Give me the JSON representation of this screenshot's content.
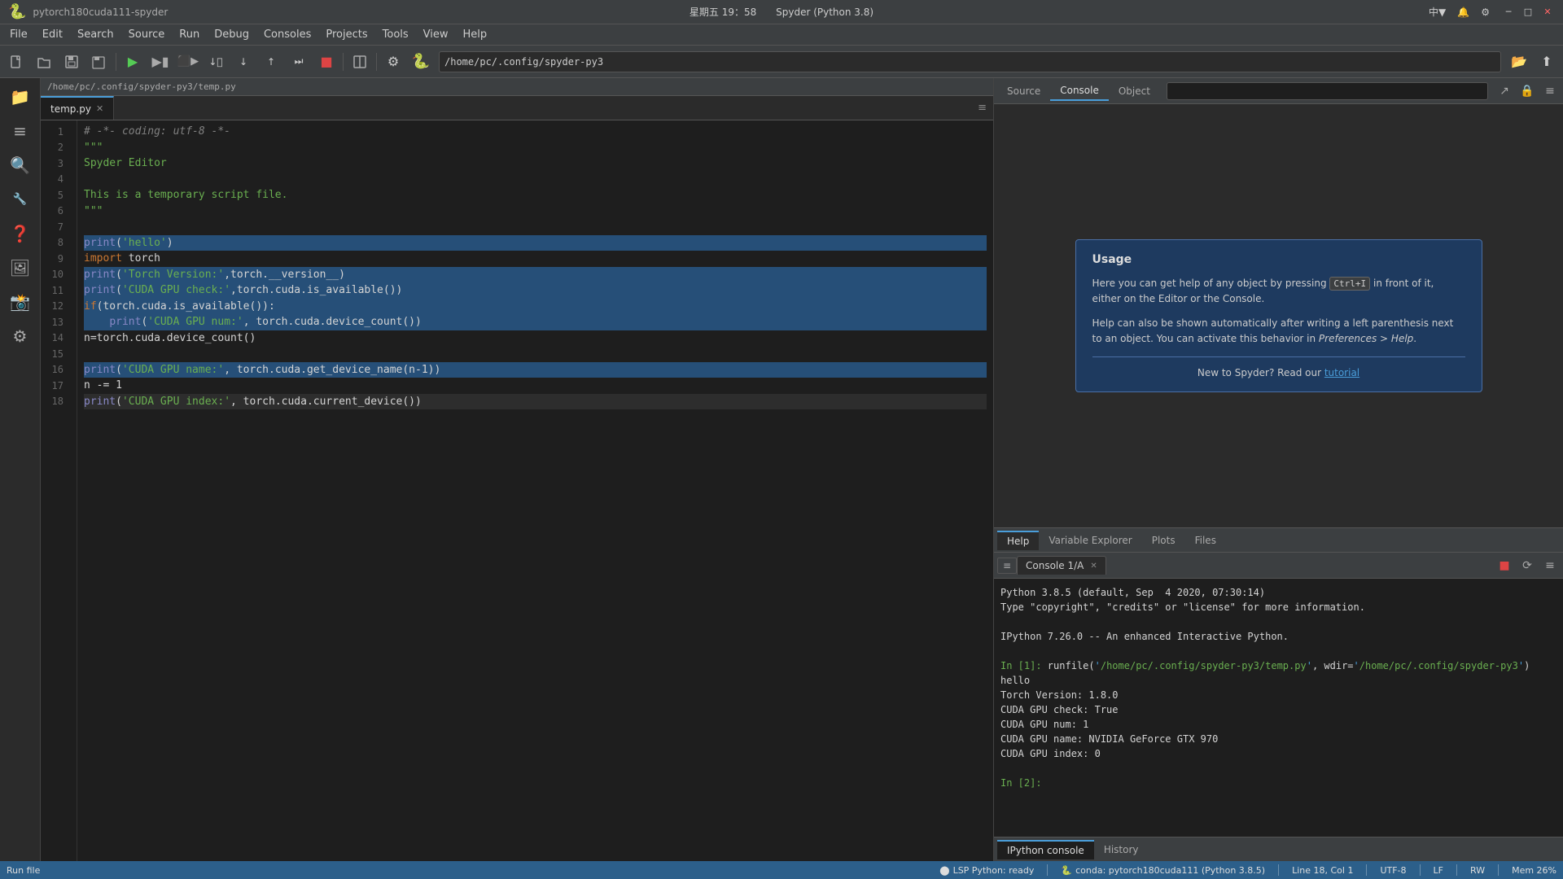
{
  "titlebar": {
    "app_name": "pytorch180cuda111-spyder",
    "time": "星期五 19：58",
    "window_title": "Spyder (Python 3.8)",
    "minimize": "─",
    "maximize": "□",
    "close": "✕",
    "lang": "中▼"
  },
  "menubar": {
    "items": [
      "File",
      "Edit",
      "Search",
      "Source",
      "Run",
      "Debug",
      "Consoles",
      "Projects",
      "Tools",
      "View",
      "Help"
    ]
  },
  "toolbar": {
    "path": "/home/pc/.config/spyder-py3",
    "buttons": [
      "new",
      "open",
      "save",
      "save-all",
      "run",
      "run-cell",
      "debug-step",
      "step-into",
      "step-out",
      "continue",
      "stop",
      "split"
    ]
  },
  "editor": {
    "path": "/home/pc/.config/spyder-py3/temp.py",
    "tab_label": "temp.py",
    "lines": [
      {
        "num": 1,
        "code": "# -*- coding: utf-8 -*-",
        "type": "comment"
      },
      {
        "num": 2,
        "code": "\"\"\"",
        "type": "string"
      },
      {
        "num": 3,
        "code": "Spyder Editor",
        "type": "string"
      },
      {
        "num": 4,
        "code": "",
        "type": "normal"
      },
      {
        "num": 5,
        "code": "This is a temporary script file.",
        "type": "string"
      },
      {
        "num": 6,
        "code": "\"\"\"",
        "type": "string"
      },
      {
        "num": 7,
        "code": "",
        "type": "normal"
      },
      {
        "num": 8,
        "code": "print('hello')",
        "type": "highlighted"
      },
      {
        "num": 9,
        "code": "import torch",
        "type": "normal"
      },
      {
        "num": 10,
        "code": "print('Torch Version:',torch.__version__)",
        "type": "highlighted"
      },
      {
        "num": 11,
        "code": "print('CUDA GPU check:',torch.cuda.is_available())",
        "type": "highlighted"
      },
      {
        "num": 12,
        "code": "if(torch.cuda.is_available()):",
        "type": "highlighted"
      },
      {
        "num": 13,
        "code": "    print('CUDA GPU num:', torch.cuda.device_count())",
        "type": "highlighted"
      },
      {
        "num": 14,
        "code": "n=torch.cuda.device_count()",
        "type": "normal"
      },
      {
        "num": 15,
        "code": "",
        "type": "normal"
      },
      {
        "num": 16,
        "code": "print('CUDA GPU name:', torch.cuda.get_device_name(n-1))",
        "type": "highlighted"
      },
      {
        "num": 17,
        "code": "n -= 1",
        "type": "normal"
      },
      {
        "num": 18,
        "code": "print('CUDA GPU index:', torch.cuda.current_device())",
        "type": "current"
      }
    ]
  },
  "help_panel": {
    "tabs": [
      "Source",
      "Console",
      "Object"
    ],
    "active_tab": "Console",
    "object_placeholder": "",
    "usage": {
      "title": "Usage",
      "text1": "Here you can get help of any object by pressing Ctrl+I in front of it, either on the Editor or the Console.",
      "text2": "Help can also be shown automatically after writing a left parenthesis next to an object. You can activate this behavior in Preferences > Help.",
      "link_text": "New to Spyder? Read our tutorial",
      "link": "tutorial"
    },
    "bottom_tabs": [
      "Help",
      "Variable Explorer",
      "Plots",
      "Files"
    ]
  },
  "console": {
    "tab_label": "Console 1/A",
    "content": [
      "Python 3.8.5 (default, Sep  4 2020, 07:30:14)",
      "Type \"copyright\", \"credits\" or \"license\" for more information.",
      "",
      "IPython 7.26.0 -- An enhanced Interactive Python.",
      "",
      "In [1]: runfile('/home/pc/.config/spyder-py3/temp.py', wdir='/home/pc/.config/spyder-py3')",
      "hello",
      "Torch Version: 1.8.0",
      "CUDA GPU check: True",
      "CUDA GPU num: 1",
      "CUDA GPU name: NVIDIA GeForce GTX 970",
      "CUDA GPU index: 0",
      "",
      "In [2]: "
    ],
    "bottom_tabs": [
      "IPython console",
      "History"
    ],
    "active_bottom_tab": "IPython console"
  },
  "statusbar": {
    "lsp": "LSP Python: ready",
    "conda": "conda: pytorch180cuda111 (Python 3.8.5)",
    "position": "Line 18, Col 1",
    "encoding": "UTF-8",
    "endings": "LF",
    "permissions": "RW",
    "memory": "Mem 26%"
  },
  "sidebar": {
    "icons": [
      "🐍",
      "📁",
      "🔍",
      "🔧",
      "❓",
      "🖼️",
      "📸",
      "⚙️"
    ]
  }
}
